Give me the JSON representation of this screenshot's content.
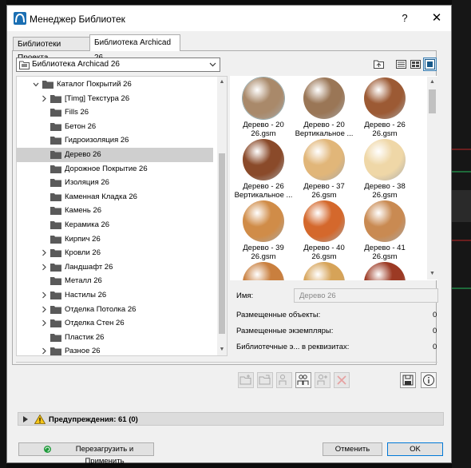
{
  "window": {
    "title": "Менеджер Библиотек",
    "help_label": "?",
    "close_label": "✕"
  },
  "tabs": [
    {
      "label": "Библиотеки Проекта",
      "active": false
    },
    {
      "label": "Библиотека Archicad 26",
      "active": true
    }
  ],
  "library_select": {
    "value": "Библиотека Archicad 26"
  },
  "tree": {
    "items": [
      {
        "label": "Каталог Покрытий 26",
        "level": 1,
        "expand": "expanded"
      },
      {
        "label": "[Timg] Текстура 26",
        "level": 2,
        "expand": "collapsed"
      },
      {
        "label": "Fills 26",
        "level": 2,
        "expand": "none"
      },
      {
        "label": "Бетон 26",
        "level": 2,
        "expand": "none"
      },
      {
        "label": "Гидроизоляция 26",
        "level": 2,
        "expand": "none"
      },
      {
        "label": "Дерево 26",
        "level": 2,
        "expand": "none",
        "selected": true
      },
      {
        "label": "Дорожное Покрытие 26",
        "level": 2,
        "expand": "none"
      },
      {
        "label": "Изоляция 26",
        "level": 2,
        "expand": "none"
      },
      {
        "label": "Каменная Кладка 26",
        "level": 2,
        "expand": "none"
      },
      {
        "label": "Камень 26",
        "level": 2,
        "expand": "none"
      },
      {
        "label": "Керамика 26",
        "level": 2,
        "expand": "none"
      },
      {
        "label": "Кирпич 26",
        "level": 2,
        "expand": "none"
      },
      {
        "label": "Кровли 26",
        "level": 2,
        "expand": "collapsed"
      },
      {
        "label": "Ландшафт 26",
        "level": 2,
        "expand": "collapsed"
      },
      {
        "label": "Металл 26",
        "level": 2,
        "expand": "none"
      },
      {
        "label": "Настилы 26",
        "level": 2,
        "expand": "collapsed"
      },
      {
        "label": "Отделка Потолка 26",
        "level": 2,
        "expand": "collapsed"
      },
      {
        "label": "Отделка Стен 26",
        "level": 2,
        "expand": "collapsed"
      },
      {
        "label": "Пластик 26",
        "level": 2,
        "expand": "none"
      },
      {
        "label": "Разное 26",
        "level": 2,
        "expand": "collapsed"
      }
    ]
  },
  "thumbnails": [
    {
      "line1": "Дерево - 20",
      "line2": "26.gsm",
      "color": "#a9896a",
      "selected": true
    },
    {
      "line1": "Дерево - 20",
      "line2": "Вертикальное ...",
      "color": "#9a7656"
    },
    {
      "line1": "Дерево - 26",
      "line2": "26.gsm",
      "color": "#9c5a34"
    },
    {
      "line1": "Дерево - 26",
      "line2": "Вертикальное ...",
      "color": "#8a4a2a"
    },
    {
      "line1": "Дерево - 37",
      "line2": "26.gsm",
      "color": "#e1b679"
    },
    {
      "line1": "Дерево - 38",
      "line2": "26.gsm",
      "color": "#efd7a7"
    },
    {
      "line1": "Дерево - 39",
      "line2": "26.gsm",
      "color": "#d08c48"
    },
    {
      "line1": "Дерево - 40",
      "line2": "26.gsm",
      "color": "#d4682c"
    },
    {
      "line1": "Дерево - 41",
      "line2": "26.gsm",
      "color": "#c98a52"
    },
    {
      "line1": "",
      "line2": "",
      "color": "#c97f3e"
    },
    {
      "line1": "",
      "line2": "",
      "color": "#d6a358"
    },
    {
      "line1": "",
      "line2": "",
      "color": "#9c3a24"
    }
  ],
  "properties": {
    "name_label": "Имя:",
    "name_value": "Дерево 26",
    "placed_objects_label": "Размещенные объекты:",
    "placed_objects_value": "0",
    "placed_instances_label": "Размещенные экземпляры:",
    "placed_instances_value": "0",
    "requisites_label": "Библиотечные э... в реквизитах:",
    "requisites_value": "0"
  },
  "warnings": {
    "label": "Предупреждения: 61 (0)"
  },
  "buttons": {
    "reload": "Перезагрузить и Применить",
    "cancel": "Отменить",
    "ok": "OK"
  },
  "colors": {
    "accent": "#0078d7",
    "selection": "#cfcfcf"
  }
}
